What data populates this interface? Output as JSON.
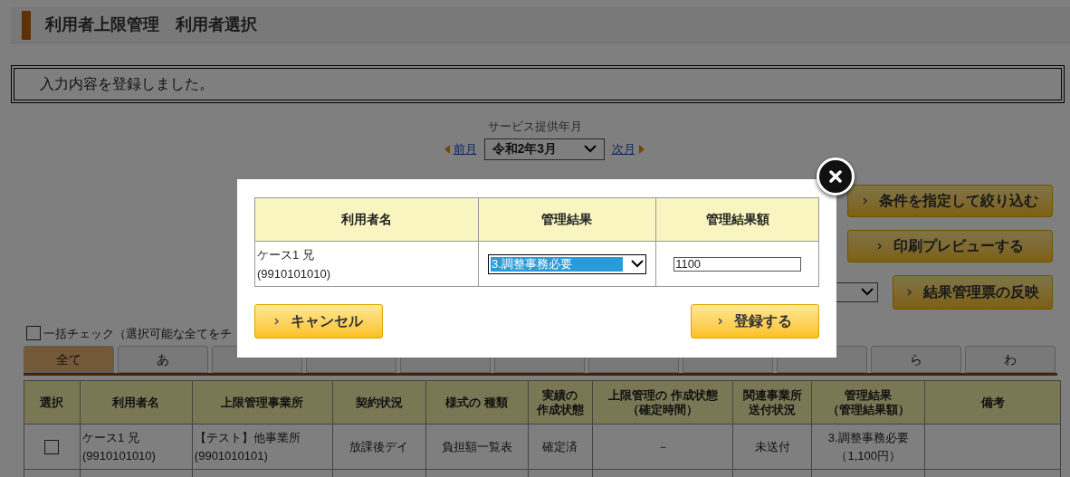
{
  "page_title": "利用者上限管理　利用者選択",
  "message": "入力内容を登録しました。",
  "period": {
    "label": "サービス提供年月",
    "prev": "前月",
    "value": "令和2年3月",
    "next": "次月"
  },
  "actions": [
    {
      "label": "条件を指定して絞り込む"
    },
    {
      "label": "印刷プレビューする"
    }
  ],
  "reflect_button": "結果管理票の反映",
  "bulk_check": {
    "label": "一括チェック（選択可能な全てをチ",
    "checked": false
  },
  "kana_tabs": [
    {
      "label": "全て",
      "selected": true
    },
    {
      "label": "あ",
      "selected": false
    },
    {
      "selected": false
    },
    {
      "selected": false
    },
    {
      "selected": false
    },
    {
      "selected": false
    },
    {
      "selected": false
    },
    {
      "selected": false
    },
    {
      "selected": false
    },
    {
      "label": "ら",
      "selected": false
    },
    {
      "label": "わ",
      "selected": false
    }
  ],
  "table": {
    "columns": [
      {
        "lines": [
          "選択"
        ]
      },
      {
        "lines": [
          "利用者名"
        ]
      },
      {
        "lines": [
          "上限管理事業所"
        ]
      },
      {
        "lines": [
          "契約状況"
        ]
      },
      {
        "lines": [
          "様式の 種類"
        ]
      },
      {
        "lines": [
          "実績の",
          "作成状態"
        ]
      },
      {
        "lines": [
          "上限管理の 作成状態",
          "（確定時間）"
        ]
      },
      {
        "lines": [
          "関連事業所",
          "送付状況"
        ]
      },
      {
        "lines": [
          "管理結果",
          "（管理結果額）"
        ]
      },
      {
        "lines": [
          "備考"
        ]
      }
    ],
    "rows": [
      {
        "cells": [
          {
            "kind": "checkbox",
            "checked": false
          },
          {
            "kind": "text",
            "lines": [
              "ケース1 兄",
              "(9910101010)"
            ]
          },
          {
            "kind": "text",
            "lines": [
              "【テスト】他事業所",
              "(9901010101)"
            ]
          },
          {
            "kind": "text",
            "lines": [
              "放課後デイ"
            ]
          },
          {
            "kind": "text",
            "lines": [
              "負担額一覧表"
            ]
          },
          {
            "kind": "text",
            "lines": [
              "確定済"
            ]
          },
          {
            "kind": "text",
            "lines": [
              "－"
            ]
          },
          {
            "kind": "text",
            "lines": [
              "未送付"
            ]
          },
          {
            "kind": "text",
            "lines": [
              "3.調整事務必要",
              "（1,100円）"
            ]
          }
        ]
      }
    ]
  },
  "dialog": {
    "columns": [
      "利用者名",
      "管理結果",
      "管理結果額"
    ],
    "row": {
      "name": "ケース1 兄",
      "code": "(9910101010)",
      "result": "3.調整事務必要",
      "amount": "1100"
    },
    "cancel": "キャンセル",
    "submit": "登録する"
  }
}
